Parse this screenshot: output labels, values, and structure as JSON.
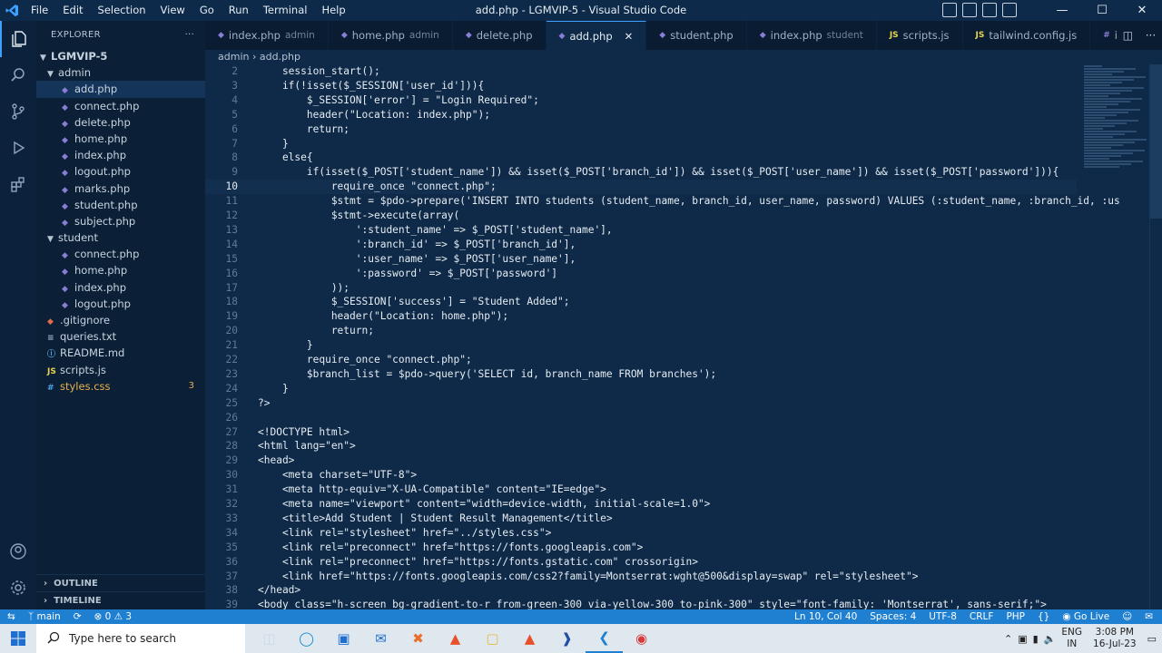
{
  "window": {
    "title": "add.php - LGMVIP-5 - Visual Studio Code",
    "menu": [
      "File",
      "Edit",
      "Selection",
      "View",
      "Go",
      "Run",
      "Terminal",
      "Help"
    ]
  },
  "sidebar": {
    "header": "EXPLORER",
    "root": "LGMVIP-5",
    "items": [
      {
        "label": "admin",
        "type": "folder",
        "indent": 1
      },
      {
        "label": "add.php",
        "type": "php",
        "indent": 2,
        "selected": true
      },
      {
        "label": "connect.php",
        "type": "php",
        "indent": 2
      },
      {
        "label": "delete.php",
        "type": "php",
        "indent": 2
      },
      {
        "label": "home.php",
        "type": "php",
        "indent": 2
      },
      {
        "label": "index.php",
        "type": "php",
        "indent": 2
      },
      {
        "label": "logout.php",
        "type": "php",
        "indent": 2
      },
      {
        "label": "marks.php",
        "type": "php",
        "indent": 2
      },
      {
        "label": "student.php",
        "type": "php",
        "indent": 2
      },
      {
        "label": "subject.php",
        "type": "php",
        "indent": 2
      },
      {
        "label": "student",
        "type": "folder",
        "indent": 1
      },
      {
        "label": "connect.php",
        "type": "php",
        "indent": 2
      },
      {
        "label": "home.php",
        "type": "php",
        "indent": 2
      },
      {
        "label": "index.php",
        "type": "php",
        "indent": 2
      },
      {
        "label": "logout.php",
        "type": "php",
        "indent": 2
      },
      {
        "label": ".gitignore",
        "type": "git",
        "indent": 1
      },
      {
        "label": "queries.txt",
        "type": "txt",
        "indent": 1
      },
      {
        "label": "README.md",
        "type": "md",
        "indent": 1
      },
      {
        "label": "scripts.js",
        "type": "js",
        "indent": 1
      },
      {
        "label": "styles.css",
        "type": "css",
        "indent": 1,
        "modified": true,
        "badge": "3"
      }
    ],
    "outline": "OUTLINE",
    "timeline": "TIMELINE"
  },
  "tabs": [
    {
      "label": "index.php",
      "desc": "admin",
      "icon": "php"
    },
    {
      "label": "home.php",
      "desc": "admin",
      "icon": "php"
    },
    {
      "label": "delete.php",
      "desc": "",
      "icon": "php"
    },
    {
      "label": "add.php",
      "desc": "",
      "icon": "php",
      "active": true
    },
    {
      "label": "student.php",
      "desc": "",
      "icon": "php"
    },
    {
      "label": "index.php",
      "desc": "student",
      "icon": "php"
    },
    {
      "label": "scripts.js",
      "desc": "",
      "icon": "js"
    },
    {
      "label": "tailwind.config.js",
      "desc": "",
      "icon": "js"
    },
    {
      "label": "input.cs",
      "desc": "",
      "icon": "css"
    }
  ],
  "breadcrumb": [
    "admin",
    "add.php"
  ],
  "editor": {
    "current_line": 10,
    "lines": [
      {
        "n": "2",
        "text": "    session_start();"
      },
      {
        "n": "3",
        "text": "    if(!isset($_SESSION['user_id'])){"
      },
      {
        "n": "4",
        "text": "        $_SESSION['error'] = \"Login Required\";"
      },
      {
        "n": "5",
        "text": "        header(\"Location: index.php\");"
      },
      {
        "n": "6",
        "text": "        return;"
      },
      {
        "n": "7",
        "text": "    }"
      },
      {
        "n": "8",
        "text": "    else{"
      },
      {
        "n": "9",
        "text": "        if(isset($_POST['student_name']) && isset($_POST['branch_id']) && isset($_POST['user_name']) && isset($_POST['password'])){"
      },
      {
        "n": "10",
        "text": "            require_once \"connect.php\";"
      },
      {
        "n": "11",
        "text": "            $stmt = $pdo->prepare('INSERT INTO students (student_name, branch_id, user_name, password) VALUES (:student_name, :branch_id, :us"
      },
      {
        "n": "12",
        "text": "            $stmt->execute(array("
      },
      {
        "n": "13",
        "text": "                ':student_name' => $_POST['student_name'],"
      },
      {
        "n": "14",
        "text": "                ':branch_id' => $_POST['branch_id'],"
      },
      {
        "n": "15",
        "text": "                ':user_name' => $_POST['user_name'],"
      },
      {
        "n": "16",
        "text": "                ':password' => $_POST['password']"
      },
      {
        "n": "17",
        "text": "            ));"
      },
      {
        "n": "18",
        "text": "            $_SESSION['success'] = \"Student Added\";"
      },
      {
        "n": "19",
        "text": "            header(\"Location: home.php\");"
      },
      {
        "n": "20",
        "text": "            return;"
      },
      {
        "n": "21",
        "text": "        }"
      },
      {
        "n": "22",
        "text": "        require_once \"connect.php\";"
      },
      {
        "n": "23",
        "text": "        $branch_list = $pdo->query('SELECT id, branch_name FROM branches');"
      },
      {
        "n": "24",
        "text": "    }"
      },
      {
        "n": "25",
        "text": "?>"
      },
      {
        "n": "26",
        "text": ""
      },
      {
        "n": "27",
        "text": "<!DOCTYPE html>"
      },
      {
        "n": "28",
        "text": "<html lang=\"en\">"
      },
      {
        "n": "29",
        "text": "<head>"
      },
      {
        "n": "30",
        "text": "    <meta charset=\"UTF-8\">"
      },
      {
        "n": "31",
        "text": "    <meta http-equiv=\"X-UA-Compatible\" content=\"IE=edge\">"
      },
      {
        "n": "32",
        "text": "    <meta name=\"viewport\" content=\"width=device-width, initial-scale=1.0\">"
      },
      {
        "n": "33",
        "text": "    <title>Add Student | Student Result Management</title>"
      },
      {
        "n": "34",
        "text": "    <link rel=\"stylesheet\" href=\"../styles.css\">"
      },
      {
        "n": "35",
        "text": "    <link rel=\"preconnect\" href=\"https://fonts.googleapis.com\">"
      },
      {
        "n": "36",
        "text": "    <link rel=\"preconnect\" href=\"https://fonts.gstatic.com\" crossorigin>"
      },
      {
        "n": "37",
        "text": "    <link href=\"https://fonts.googleapis.com/css2?family=Montserrat:wght@500&display=swap\" rel=\"stylesheet\">"
      },
      {
        "n": "38",
        "text": "</head>"
      },
      {
        "n": "39",
        "text": "<body class=\"h-screen bg-gradient-to-r from-green-300 via-yellow-300 to-pink-300\" style=\"font-family: 'Montserrat', sans-serif;\">"
      }
    ]
  },
  "statusbar": {
    "branch": "main",
    "problems": "⊗ 0 ⚠ 3",
    "position": "Ln 10, Col 40",
    "spaces": "Spaces: 4",
    "encoding": "UTF-8",
    "eol": "CRLF",
    "language": "PHP",
    "golive": "Go Live"
  },
  "taskbar": {
    "search_placeholder": "Type here to search",
    "lang_top": "ENG",
    "lang_bottom": "IN",
    "time": "3:08 PM",
    "date": "16-Jul-23"
  }
}
